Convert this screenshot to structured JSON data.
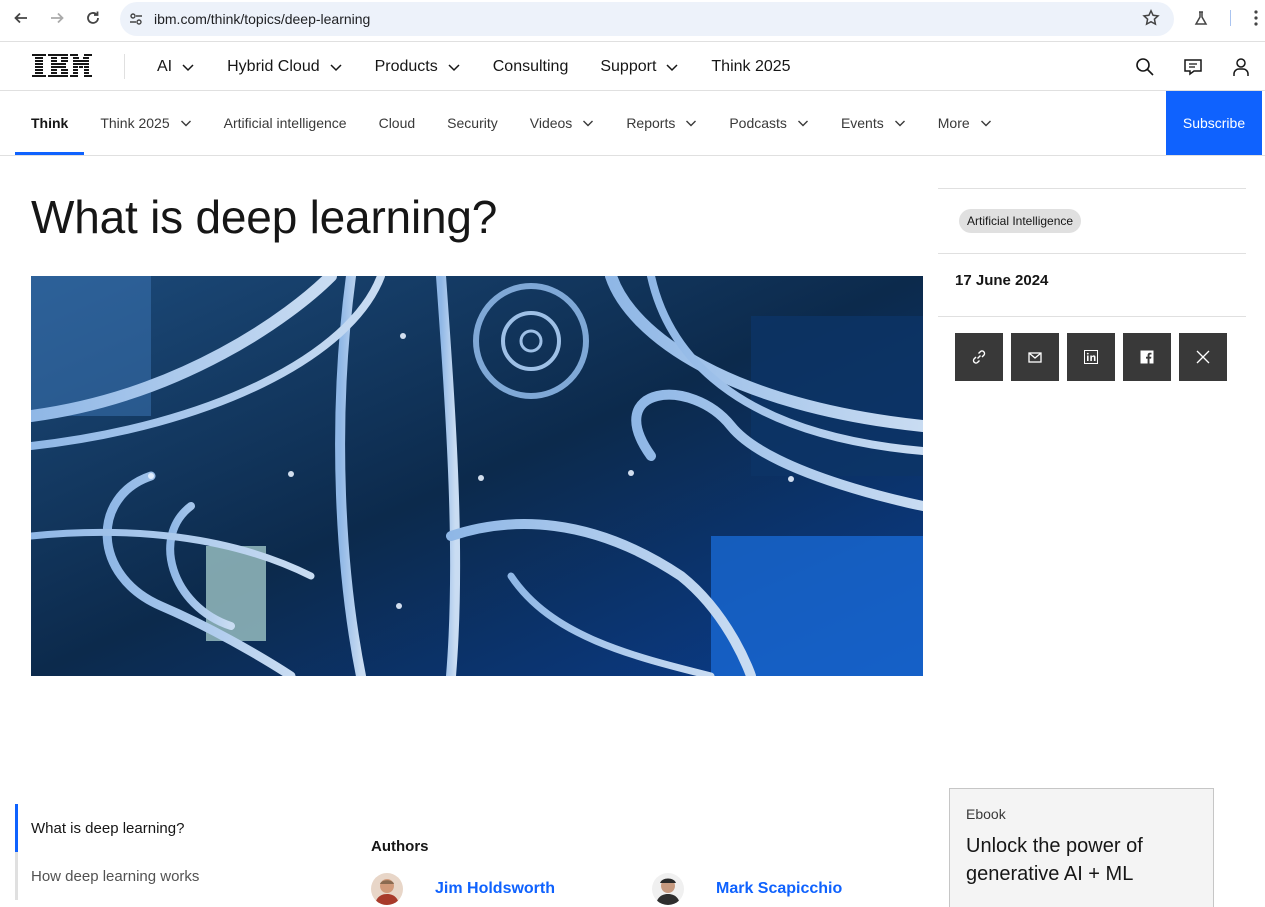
{
  "browser": {
    "url": "ibm.com/think/topics/deep-learning"
  },
  "masthead": {
    "logo_text": "IBM",
    "nav": [
      {
        "label": "AI",
        "has_menu": true
      },
      {
        "label": "Hybrid Cloud",
        "has_menu": true
      },
      {
        "label": "Products",
        "has_menu": true
      },
      {
        "label": "Consulting",
        "has_menu": false
      },
      {
        "label": "Support",
        "has_menu": true
      },
      {
        "label": "Think 2025",
        "has_menu": false
      }
    ],
    "icons": [
      "search-icon",
      "chat-icon",
      "user-icon"
    ]
  },
  "subnav": {
    "items": [
      {
        "label": "Think",
        "active": true
      },
      {
        "label": "Think 2025",
        "has_menu": true
      },
      {
        "label": "Artificial intelligence"
      },
      {
        "label": "Cloud"
      },
      {
        "label": "Security"
      },
      {
        "label": "Videos",
        "has_menu": true
      },
      {
        "label": "Reports",
        "has_menu": true
      },
      {
        "label": "Podcasts",
        "has_menu": true
      },
      {
        "label": "Events",
        "has_menu": true
      },
      {
        "label": "More",
        "has_menu": true
      }
    ],
    "subscribe_label": "Subscribe"
  },
  "article": {
    "title": "What is deep learning?",
    "tag": "Artificial Intelligence",
    "date": "17 June 2024",
    "share": [
      "link-icon",
      "email-icon",
      "linkedin-icon",
      "facebook-icon",
      "x-icon"
    ]
  },
  "toc": [
    {
      "label": "What is deep learning?",
      "active": true
    },
    {
      "label": "How deep learning works",
      "active": false
    }
  ],
  "authors": {
    "label": "Authors",
    "people": [
      {
        "name": "Jim Holdsworth"
      },
      {
        "name": "Mark Scapicchio"
      }
    ]
  },
  "ebook": {
    "kicker": "Ebook",
    "title": "Unlock the power of generative AI + ML"
  },
  "colors": {
    "accent": "#0f62fe",
    "share_bg": "#393939",
    "border": "#e0e0e0"
  }
}
